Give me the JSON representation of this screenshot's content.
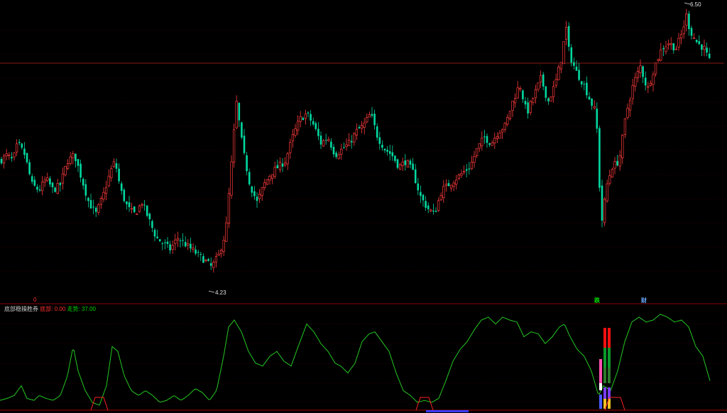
{
  "indicator": {
    "name": "底部稳操胜券",
    "bottom_label": "底部:",
    "bottom_value": "0.00",
    "trend_label": "走势:",
    "trend_value": "37.00"
  },
  "price_labels": {
    "high": "6.50",
    "low": "4.23"
  },
  "markers": {
    "die": "跌",
    "cai": "财",
    "zero": "0"
  },
  "colors": {
    "up": "#ff3b3b",
    "down": "#00d8a0",
    "trend_line": "#22c822",
    "grid": "#5a0000",
    "background": "#000000"
  },
  "chart_data": [
    {
      "type": "candlestick",
      "title": "",
      "ylim": [
        4.1,
        6.55
      ],
      "reference_price": 5.95,
      "high_point": 6.5,
      "low_point": 4.23,
      "anchors": [
        [
          0,
          5.2
        ],
        [
          10,
          5.25
        ],
        [
          18,
          5.2
        ],
        [
          25,
          5.35
        ],
        [
          35,
          5.25
        ],
        [
          45,
          5.0
        ],
        [
          55,
          4.95
        ],
        [
          65,
          5.05
        ],
        [
          75,
          4.95
        ],
        [
          85,
          5.0
        ],
        [
          95,
          5.2
        ],
        [
          105,
          5.25
        ],
        [
          115,
          5.05
        ],
        [
          125,
          4.85
        ],
        [
          135,
          4.75
        ],
        [
          145,
          4.9
        ],
        [
          155,
          5.1
        ],
        [
          162,
          5.2
        ],
        [
          170,
          4.95
        ],
        [
          180,
          4.8
        ],
        [
          190,
          4.75
        ],
        [
          200,
          4.85
        ],
        [
          210,
          4.7
        ],
        [
          220,
          4.55
        ],
        [
          230,
          4.5
        ],
        [
          240,
          4.45
        ],
        [
          250,
          4.55
        ],
        [
          260,
          4.5
        ],
        [
          270,
          4.45
        ],
        [
          280,
          4.4
        ],
        [
          290,
          4.35
        ],
        [
          298,
          4.3
        ],
        [
          308,
          4.4
        ],
        [
          318,
          4.6
        ],
        [
          325,
          5.1
        ],
        [
          333,
          5.7
        ],
        [
          342,
          5.3
        ],
        [
          352,
          5.0
        ],
        [
          362,
          4.85
        ],
        [
          372,
          5.0
        ],
        [
          382,
          5.1
        ],
        [
          392,
          5.15
        ],
        [
          402,
          5.2
        ],
        [
          412,
          5.4
        ],
        [
          422,
          5.55
        ],
        [
          432,
          5.6
        ],
        [
          442,
          5.5
        ],
        [
          452,
          5.35
        ],
        [
          462,
          5.4
        ],
        [
          472,
          5.25
        ],
        [
          482,
          5.3
        ],
        [
          492,
          5.35
        ],
        [
          502,
          5.45
        ],
        [
          512,
          5.5
        ],
        [
          522,
          5.6
        ],
        [
          532,
          5.4
        ],
        [
          542,
          5.3
        ],
        [
          552,
          5.25
        ],
        [
          562,
          5.15
        ],
        [
          572,
          5.2
        ],
        [
          582,
          5.1
        ],
        [
          592,
          4.9
        ],
        [
          602,
          4.8
        ],
        [
          612,
          4.75
        ],
        [
          622,
          4.95
        ],
        [
          632,
          5.0
        ],
        [
          642,
          5.05
        ],
        [
          652,
          5.1
        ],
        [
          662,
          5.15
        ],
        [
          672,
          5.3
        ],
        [
          682,
          5.4
        ],
        [
          692,
          5.35
        ],
        [
          702,
          5.45
        ],
        [
          712,
          5.5
        ],
        [
          722,
          5.7
        ],
        [
          732,
          5.85
        ],
        [
          742,
          5.6
        ],
        [
          752,
          5.75
        ],
        [
          762,
          5.9
        ],
        [
          772,
          5.7
        ],
        [
          782,
          5.85
        ],
        [
          792,
          6.1
        ],
        [
          797,
          6.35
        ],
        [
          802,
          6.1
        ],
        [
          812,
          5.95
        ],
        [
          822,
          5.85
        ],
        [
          832,
          5.7
        ],
        [
          840,
          5.6
        ],
        [
          843,
          5.1
        ],
        [
          848,
          4.7
        ],
        [
          855,
          5.0
        ],
        [
          862,
          5.15
        ],
        [
          872,
          5.2
        ],
        [
          882,
          5.6
        ],
        [
          892,
          5.85
        ],
        [
          902,
          6.0
        ],
        [
          912,
          5.8
        ],
        [
          922,
          6.0
        ],
        [
          932,
          6.15
        ],
        [
          942,
          6.2
        ],
        [
          952,
          6.15
        ],
        [
          962,
          6.3
        ],
        [
          966,
          6.45
        ],
        [
          972,
          6.3
        ],
        [
          982,
          6.2
        ],
        [
          992,
          6.15
        ],
        [
          1002,
          6.0
        ]
      ]
    },
    {
      "type": "line",
      "title": "",
      "ylim": [
        0,
        100
      ],
      "series": [
        {
          "name": "走势",
          "values": [
            [
              0,
              10
            ],
            [
              10,
              12
            ],
            [
              20,
              15
            ],
            [
              30,
              25
            ],
            [
              38,
              12
            ],
            [
              48,
              10
            ],
            [
              55,
              15
            ],
            [
              65,
              12
            ],
            [
              75,
              10
            ],
            [
              85,
              15
            ],
            [
              95,
              35
            ],
            [
              103,
              65
            ],
            [
              110,
              40
            ],
            [
              120,
              20
            ],
            [
              130,
              8
            ],
            [
              140,
              5
            ],
            [
              150,
              25
            ],
            [
              158,
              65
            ],
            [
              166,
              60
            ],
            [
              175,
              35
            ],
            [
              185,
              20
            ],
            [
              195,
              15
            ],
            [
              205,
              20
            ],
            [
              215,
              15
            ],
            [
              225,
              8
            ],
            [
              235,
              10
            ],
            [
              245,
              15
            ],
            [
              255,
              10
            ],
            [
              265,
              15
            ],
            [
              275,
              22
            ],
            [
              285,
              18
            ],
            [
              295,
              10
            ],
            [
              305,
              20
            ],
            [
              315,
              55
            ],
            [
              322,
              85
            ],
            [
              330,
              92
            ],
            [
              340,
              80
            ],
            [
              350,
              60
            ],
            [
              360,
              48
            ],
            [
              370,
              45
            ],
            [
              380,
              55
            ],
            [
              390,
              60
            ],
            [
              400,
              50
            ],
            [
              410,
              45
            ],
            [
              420,
              65
            ],
            [
              432,
              88
            ],
            [
              442,
              80
            ],
            [
              452,
              68
            ],
            [
              462,
              60
            ],
            [
              472,
              48
            ],
            [
              480,
              45
            ],
            [
              490,
              38
            ],
            [
              500,
              48
            ],
            [
              510,
              70
            ],
            [
              520,
              78
            ],
            [
              528,
              80
            ],
            [
              538,
              70
            ],
            [
              548,
              60
            ],
            [
              558,
              38
            ],
            [
              568,
              20
            ],
            [
              578,
              15
            ],
            [
              588,
              8
            ],
            [
              598,
              10
            ],
            [
              608,
              8
            ],
            [
              618,
              12
            ],
            [
              628,
              30
            ],
            [
              638,
              50
            ],
            [
              648,
              62
            ],
            [
              658,
              70
            ],
            [
              668,
              82
            ],
            [
              678,
              92
            ],
            [
              688,
              95
            ],
            [
              698,
              88
            ],
            [
              708,
              95
            ],
            [
              718,
              92
            ],
            [
              728,
              90
            ],
            [
              738,
              75
            ],
            [
              748,
              80
            ],
            [
              758,
              78
            ],
            [
              768,
              68
            ],
            [
              778,
              75
            ],
            [
              788,
              85
            ],
            [
              795,
              88
            ],
            [
              803,
              75
            ],
            [
              813,
              62
            ],
            [
              823,
              55
            ],
            [
              833,
              40
            ],
            [
              843,
              15
            ],
            [
              850,
              25
            ],
            [
              860,
              20
            ],
            [
              870,
              40
            ],
            [
              880,
              70
            ],
            [
              890,
              90
            ],
            [
              900,
              95
            ],
            [
              910,
              90
            ],
            [
              920,
              92
            ],
            [
              930,
              98
            ],
            [
              940,
              95
            ],
            [
              950,
              90
            ],
            [
              960,
              92
            ],
            [
              970,
              85
            ],
            [
              980,
              65
            ],
            [
              990,
              55
            ],
            [
              1000,
              30
            ]
          ]
        }
      ]
    }
  ]
}
